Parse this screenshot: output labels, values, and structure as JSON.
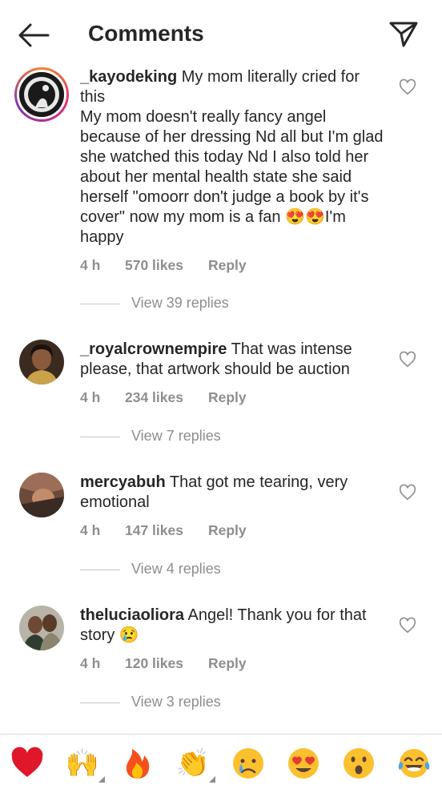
{
  "header": {
    "title": "Comments",
    "back_icon": "arrow-left-icon",
    "send_icon": "paper-plane-icon"
  },
  "comments": [
    {
      "username": "_kayodeking",
      "text": " My mom literally cried for this\nMy mom doesn't really fancy angel because of her dressing Nd all but I'm glad she watched this today Nd I also told her about her mental health state she said herself \"omoorr don't judge a book by it's cover\" now my mom is a fan 😍😍I'm happy",
      "time": "4 h",
      "likes": "570 likes",
      "reply": "Reply",
      "view_replies": "View 39 replies",
      "has_story": true
    },
    {
      "username": "_royalcrownempire",
      "text": " That was intense please, that artwork should be auction",
      "time": "4 h",
      "likes": "234 likes",
      "reply": "Reply",
      "view_replies": "View 7 replies",
      "has_story": false
    },
    {
      "username": "mercyabuh",
      "text": " That got me tearing, very emotional",
      "time": "4 h",
      "likes": "147 likes",
      "reply": "Reply",
      "view_replies": "View 4 replies",
      "has_story": false
    },
    {
      "username": "theluciaoliora",
      "text": " Angel! Thank you for that story 😢",
      "time": "4 h",
      "likes": "120 likes",
      "reply": "Reply",
      "view_replies": "View 3 replies",
      "has_story": false
    }
  ],
  "emoji_bar": [
    {
      "name": "red-heart-emoji",
      "glyph": "❤️",
      "has_variants": false
    },
    {
      "name": "raising-hands-emoji",
      "glyph": "🙌",
      "has_variants": true
    },
    {
      "name": "fire-emoji",
      "glyph": "🔥",
      "has_variants": false
    },
    {
      "name": "clapping-hands-emoji",
      "glyph": "👏",
      "has_variants": true
    },
    {
      "name": "crying-face-emoji",
      "glyph": "😢",
      "has_variants": false
    },
    {
      "name": "heart-eyes-emoji",
      "glyph": "😍",
      "has_variants": false
    },
    {
      "name": "surprised-face-emoji",
      "glyph": "😮",
      "has_variants": false
    },
    {
      "name": "tears-of-joy-emoji",
      "glyph": "😂",
      "has_variants": false
    }
  ],
  "colors": {
    "text": "#262626",
    "secondary": "#8e8e8e",
    "divider": "#dbdbdb",
    "story_ring": "#dd2a7b"
  }
}
